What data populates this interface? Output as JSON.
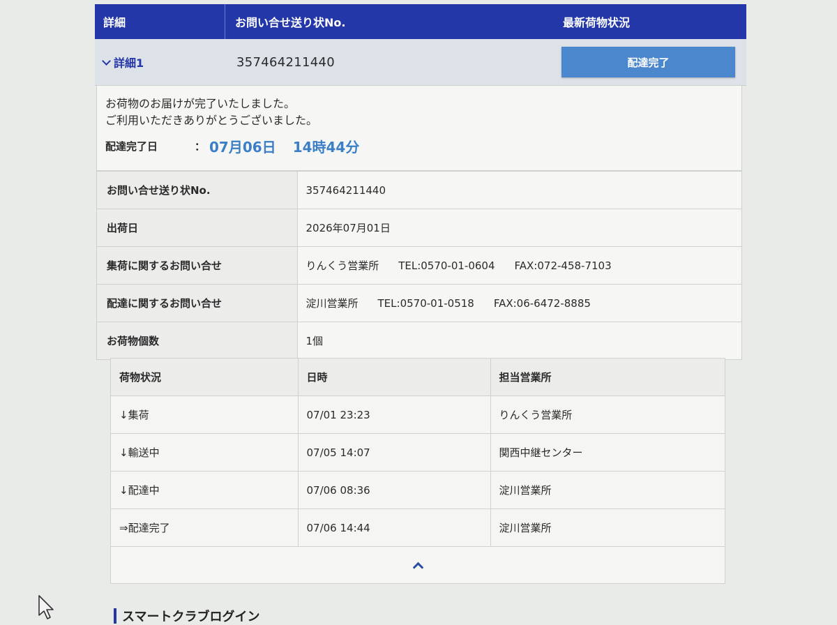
{
  "header": {
    "col_detail": "詳細",
    "col_tracking": "お問い合せ送り状No.",
    "col_status": "最新荷物状況"
  },
  "item": {
    "toggle_label": "詳細1",
    "tracking_no": "357464211440",
    "status_button": "配達完了"
  },
  "message": {
    "line1": "お荷物のお届けが完了いたしました。",
    "line2": "ご利用いただきありがとうございました。",
    "delivered_label": "配達完了日",
    "colon": "：",
    "delivered_date": "07月06日",
    "delivered_time": "14時44分"
  },
  "info": [
    {
      "key": "お問い合せ送り状No.",
      "value": "357464211440"
    },
    {
      "key": "出荷日",
      "value": "2026年07月01日"
    },
    {
      "key": "集荷に関するお問い合せ",
      "office": "りんくう営業所",
      "tel": "TEL:0570-01-0604",
      "fax": "FAX:072-458-7103"
    },
    {
      "key": "配達に関するお問い合せ",
      "office": "淀川営業所",
      "tel": "TEL:0570-01-0518",
      "fax": "FAX:06-6472-8885"
    },
    {
      "key": "お荷物個数",
      "value": "1個"
    }
  ],
  "history": {
    "headers": [
      "荷物状況",
      "日時",
      "担当営業所"
    ],
    "rows": [
      {
        "status": "↓集荷",
        "datetime": "07/01 23:23",
        "office": "りんくう営業所"
      },
      {
        "status": "↓輸送中",
        "datetime": "07/05 14:07",
        "office": "関西中継センター"
      },
      {
        "status": "↓配達中",
        "datetime": "07/06 08:36",
        "office": "淀川営業所"
      },
      {
        "status": "⇒配達完了",
        "datetime": "07/06 14:44",
        "office": "淀川営業所"
      }
    ]
  },
  "footer": {
    "section_title": "スマートクラブログイン"
  },
  "colors": {
    "header_bg": "#2337a8",
    "status_button_bg": "#4a87cc",
    "date_accent": "#3b7fc6"
  }
}
